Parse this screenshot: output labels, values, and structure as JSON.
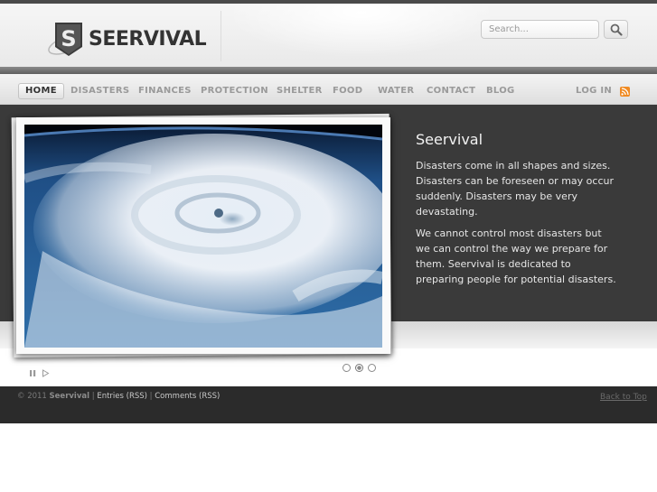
{
  "brand": {
    "logo_text": "SEERVIVAL",
    "logo_alt_glyph": "S"
  },
  "search": {
    "placeholder": "Search...",
    "icon": "search-icon"
  },
  "nav": {
    "items": [
      {
        "label": "HOME",
        "active": true
      },
      {
        "label": "DISASTERS",
        "active": false
      },
      {
        "label": "FINANCES",
        "active": false
      },
      {
        "label": "PROTECTION",
        "active": false
      },
      {
        "label": "SHELTER",
        "active": false
      },
      {
        "label": "FOOD",
        "active": false
      },
      {
        "label": "WATER",
        "active": false
      },
      {
        "label": "CONTACT",
        "active": false
      },
      {
        "label": "BLOG",
        "active": false
      }
    ],
    "login_label": "LOG IN",
    "rss_icon": "rss-icon"
  },
  "slide": {
    "title": "Seervival",
    "paragraph1": "Disasters come in all shapes and sizes. Disasters can be foreseen or may occur suddenly. Disasters may be very devastating.",
    "paragraph2": "We cannot control most disasters but we can control the way we prepare for them. Seervival is dedicated to preparing people for potential disasters.",
    "image": "hurricane-from-space-image"
  },
  "slider_controls": {
    "pause_icon": "pause-icon",
    "next_icon": "play-next-icon",
    "dot_count": 3,
    "active_dot": 1
  },
  "footer": {
    "copyright": "© 2011",
    "brand": "Seervival",
    "sep1": " | ",
    "entries": "Entries (RSS)",
    "sep2": " | ",
    "comments": "Comments (RSS)",
    "back_to_top": "Back to Top"
  },
  "colors": {
    "dark_band": "#3a3a3a",
    "footer": "#2b2b2b",
    "rss": "#f08a22",
    "nav_text": "#9a9a9a"
  }
}
